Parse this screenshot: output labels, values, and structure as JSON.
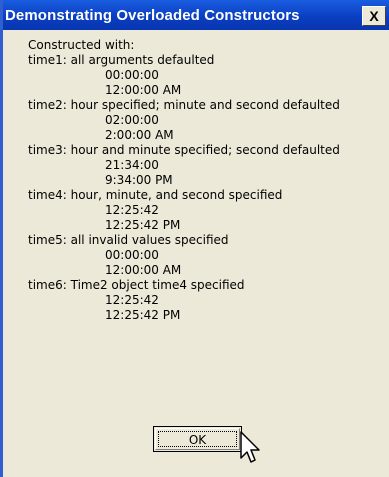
{
  "window": {
    "title": "Demonstrating Overloaded Constructors",
    "close_glyph": "X"
  },
  "message": {
    "lines": [
      {
        "text": "Constructed with:",
        "indent": false
      },
      {
        "text": "time1: all arguments defaulted",
        "indent": false
      },
      {
        "text": "00:00:00",
        "indent": true
      },
      {
        "text": "12:00:00 AM",
        "indent": true
      },
      {
        "text": "time2: hour specified; minute and second defaulted",
        "indent": false
      },
      {
        "text": "02:00:00",
        "indent": true
      },
      {
        "text": "2:00:00 AM",
        "indent": true
      },
      {
        "text": "time3: hour and minute specified; second defaulted",
        "indent": false
      },
      {
        "text": "21:34:00",
        "indent": true
      },
      {
        "text": "9:34:00 PM",
        "indent": true
      },
      {
        "text": "time4: hour, minute, and second specified",
        "indent": false
      },
      {
        "text": "12:25:42",
        "indent": true
      },
      {
        "text": "12:25:42 PM",
        "indent": true
      },
      {
        "text": "time5: all invalid values specified",
        "indent": false
      },
      {
        "text": "00:00:00",
        "indent": true
      },
      {
        "text": "12:00:00 AM",
        "indent": true
      },
      {
        "text": "time6: Time2 object time4 specified",
        "indent": false
      },
      {
        "text": "12:25:42",
        "indent": true
      },
      {
        "text": "12:25:42 PM",
        "indent": true
      }
    ]
  },
  "buttons": {
    "ok_label": "OK"
  },
  "colors": {
    "titlebar": "#0a3fc2",
    "dialog_background": "#ece9d8",
    "text": "#000000"
  },
  "icons": {
    "close": "close-icon",
    "cursor": "mouse-pointer-icon"
  }
}
